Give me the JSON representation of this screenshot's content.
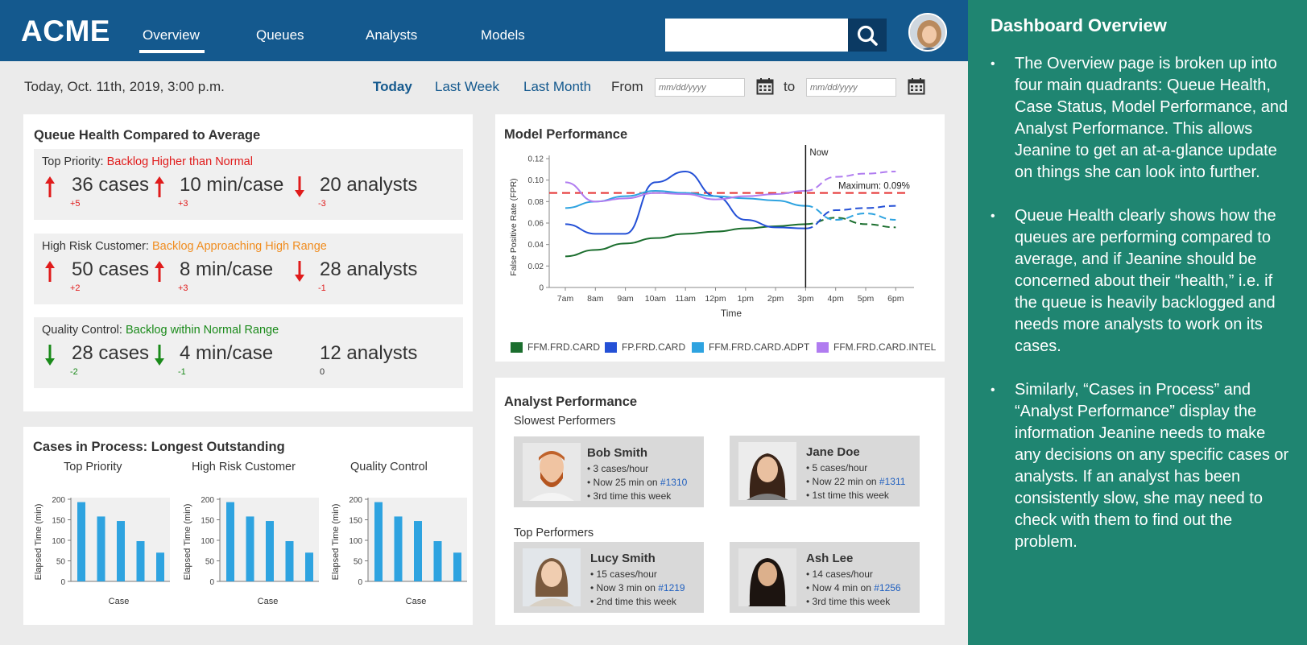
{
  "header": {
    "logo": "ACME",
    "nav": [
      "Overview",
      "Queues",
      "Analysts",
      "Models"
    ],
    "search_placeholder": ""
  },
  "date_row": {
    "current": "Today, Oct. 11th, 2019, 3:00 p.m.",
    "ranges": [
      "Today",
      "Last Week",
      "Last Month"
    ],
    "from_label": "From",
    "to_label": "to",
    "date_placeholder": "mm/dd/yyyy"
  },
  "queue_health": {
    "title": "Queue Health Compared to Average",
    "rows": [
      {
        "name": "Top Priority:",
        "status": "Backlog Higher than Normal",
        "status_color": "#e01b1b",
        "stats": [
          {
            "value": "36 cases",
            "delta": "+5",
            "dir": "up"
          },
          {
            "value": "10 min/case",
            "delta": "+3",
            "dir": "up"
          },
          {
            "value": "20 analysts",
            "delta": "-3",
            "dir": "down"
          }
        ]
      },
      {
        "name": "High Risk Customer:",
        "status": "Backlog Approaching High Range",
        "status_color": "#f08c1e",
        "stats": [
          {
            "value": "50 cases",
            "delta": "+2",
            "dir": "up"
          },
          {
            "value": "8 min/case",
            "delta": "+3",
            "dir": "up"
          },
          {
            "value": "28 analysts",
            "delta": "-1",
            "dir": "down"
          }
        ]
      },
      {
        "name": "Quality Control:",
        "status": "Backlog within Normal Range",
        "status_color": "#1a8a1a",
        "stats": [
          {
            "value": "28 cases",
            "delta": "-2",
            "dir": "down-green"
          },
          {
            "value": "4 min/case",
            "delta": "-1",
            "dir": "down-green"
          },
          {
            "value": "12 analysts",
            "delta": "0",
            "dir": "none"
          }
        ]
      }
    ]
  },
  "cases_in_process": {
    "title": "Cases in Process: Longest Outstanding",
    "charts": [
      "Top Priority",
      "High Risk Customer",
      "Quality Control"
    ],
    "ylabel": "Elapsed Time (min)",
    "xlabel": "Case",
    "yticks": [
      "0",
      "50",
      "100",
      "150",
      "200"
    ]
  },
  "model_performance": {
    "title": "Model Performance",
    "now_label": "Now",
    "max_label": "Maximum: 0.09%"
  },
  "analyst_performance": {
    "title": "Analyst Performance",
    "slowest_label": "Slowest Performers",
    "top_label": "Top Performers",
    "slowest": [
      {
        "name": "Bob Smith",
        "rate": "• 3 cases/hour",
        "now_prefix": "• Now 25 min on ",
        "case": "#1310",
        "times": "• 3rd time this week"
      },
      {
        "name": "Jane Doe",
        "rate": "• 5 cases/hour",
        "now_prefix": "• Now 22 min on ",
        "case": "#1311",
        "times": "• 1st time this week"
      }
    ],
    "top": [
      {
        "name": "Lucy Smith",
        "rate": "• 15 cases/hour",
        "now_prefix": "• Now 3 min on ",
        "case": "#1219",
        "times": "• 2nd time this week"
      },
      {
        "name": "Ash Lee",
        "rate": "• 14 cases/hour",
        "now_prefix": "• Now 4 min on ",
        "case": "#1256",
        "times": "• 3rd time this week"
      }
    ]
  },
  "side_panel": {
    "title": "Dashboard Overview",
    "bullets": [
      "The Overview page is broken up into four main quadrants: Queue Health, Case Status, Model Performance, and Analyst Performance. This allows Jeanine to get an at-a-glance update on things she can look into further.",
      "Queue Health clearly shows how the queues are performing compared to average, and if Jeanine should be concerned about their “health,” i.e. if the queue is heavily backlogged and needs more analysts to work on its cases.",
      "Similarly, “Cases in Process” and “Analyst Performance” display the information Jeanine needs to make any decisions on any specific cases or analysts. If an analyst has been consistently slow, she may need to check with them to find out the problem."
    ]
  },
  "chart_data": [
    {
      "type": "line",
      "title": "Model Performance",
      "xlabel": "Time",
      "ylabel": "False Positive Rate (FPR)",
      "x": [
        "7am",
        "8am",
        "9am",
        "10am",
        "11am",
        "12pm",
        "1pm",
        "2pm",
        "3pm",
        "4pm",
        "5pm",
        "6pm"
      ],
      "yticks": [
        "0",
        "0.02",
        "0.04",
        "0.06",
        "0.08",
        "0.10",
        "0.12"
      ],
      "ylim": [
        0,
        0.12
      ],
      "threshold": 0.088,
      "series": [
        {
          "name": "FFM.FRD.CARD",
          "color": "#1b6e2e",
          "values": [
            0.029,
            0.035,
            0.041,
            0.046,
            0.05,
            0.052,
            0.055,
            0.057,
            0.059,
            0.065,
            0.059,
            0.056
          ]
        },
        {
          "name": "FP.FRD.CARD",
          "color": "#2450d6",
          "values": [
            0.059,
            0.05,
            0.05,
            0.098,
            0.108,
            0.085,
            0.063,
            0.056,
            0.055,
            0.072,
            0.074,
            0.076
          ]
        },
        {
          "name": "FFM.FRD.CARD.ADPT",
          "color": "#2ea3e0",
          "values": [
            0.074,
            0.08,
            0.085,
            0.09,
            0.088,
            0.085,
            0.083,
            0.081,
            0.076,
            0.063,
            0.069,
            0.063
          ]
        },
        {
          "name": "FFM.FRD.CARD.INTEL",
          "color": "#b07cf0",
          "values": [
            0.098,
            0.08,
            0.083,
            0.088,
            0.087,
            0.082,
            0.085,
            0.087,
            0.09,
            0.103,
            0.106,
            0.108
          ]
        }
      ]
    },
    {
      "type": "bar",
      "title": "Top Priority",
      "xlabel": "Case",
      "ylabel": "Elapsed Time (min)",
      "ylim": [
        0,
        200
      ],
      "values": [
        193,
        158,
        147,
        98,
        70
      ],
      "color": "#2ea3e0"
    },
    {
      "type": "bar",
      "title": "High Risk Customer",
      "xlabel": "Case",
      "ylabel": "Elapsed Time (min)",
      "ylim": [
        0,
        200
      ],
      "values": [
        193,
        158,
        147,
        98,
        70
      ],
      "color": "#2ea3e0"
    },
    {
      "type": "bar",
      "title": "Quality Control",
      "xlabel": "Case",
      "ylabel": "Elapsed Time (min)",
      "ylim": [
        0,
        200
      ],
      "values": [
        193,
        158,
        147,
        98,
        70
      ],
      "color": "#2ea3e0"
    }
  ]
}
